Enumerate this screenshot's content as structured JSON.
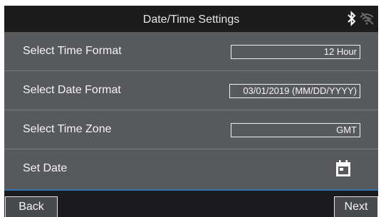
{
  "header": {
    "title": "Date/Time Settings",
    "icons": [
      "bluetooth-icon",
      "wifi-off-icon"
    ]
  },
  "settings": {
    "time_format": {
      "label": "Select Time Format",
      "value": "12 Hour"
    },
    "date_format": {
      "label": "Select Date Format",
      "value": "03/01/2019 (MM/DD/YYYY)"
    },
    "time_zone": {
      "label": "Select Time Zone",
      "value": "GMT"
    },
    "set_date": {
      "label": "Set Date",
      "icon": "calendar-icon"
    }
  },
  "footer": {
    "back_label": "Back",
    "next_label": "Next"
  },
  "colors": {
    "title_bar": "#1c1c1c",
    "panel": "#57595c",
    "accent": "#2f6fb4"
  }
}
